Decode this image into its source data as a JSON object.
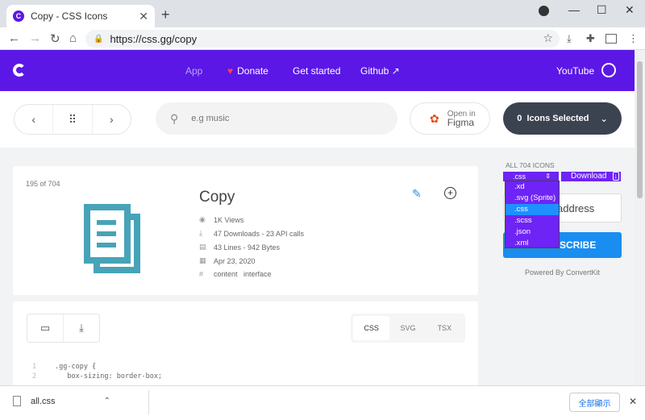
{
  "browser": {
    "tab_title": "Copy - CSS Icons",
    "tab_favicon": "C",
    "url": "https://css.gg/copy"
  },
  "site_nav": {
    "app": "App",
    "donate": "Donate",
    "get_started": "Get started",
    "github": "Github",
    "github_arrow": "↗",
    "youtube": "YouTube"
  },
  "controls": {
    "search_placeholder": "e.g music",
    "figma_line1": "Open in",
    "figma_line2": "Figma",
    "selected_label": "0  Icons Selected"
  },
  "icon": {
    "count": "195 of 704",
    "name": "Copy",
    "views": "1K Views",
    "downloads": "47 Downloads - 23 API calls",
    "lines": "43 Lines - 942 Bytes",
    "date": "Apr 23, 2020",
    "tags": "content   interface"
  },
  "code": {
    "tabs": [
      "CSS",
      "SVG",
      "TSX"
    ],
    "active_tab": "CSS",
    "lines": [
      {
        "n": "1",
        "text": ".gg-copy {"
      },
      {
        "n": "2",
        "text": "   box-sizing: border-box;"
      }
    ]
  },
  "sidebar": {
    "all_icons": "ALL 704 ICONS",
    "select_value": ".css",
    "download_label": "Download",
    "email_text": "address",
    "subscribe_text": "SCRIBE",
    "powered_by": "Powered By ConvertKit",
    "dropdown_options": [
      ".xd",
      ".svg (Sprite)",
      ".css",
      ".scss",
      ".json",
      ".xml"
    ],
    "dropdown_highlight": ".css"
  },
  "download_bar": {
    "file_name": "all.css",
    "show_all": "全部顯示"
  },
  "colors": {
    "brand": "#5b17e6",
    "icon_teal": "#47a3b8",
    "dark_button": "#3b4350",
    "subscribe_blue": "#1a8df0"
  }
}
